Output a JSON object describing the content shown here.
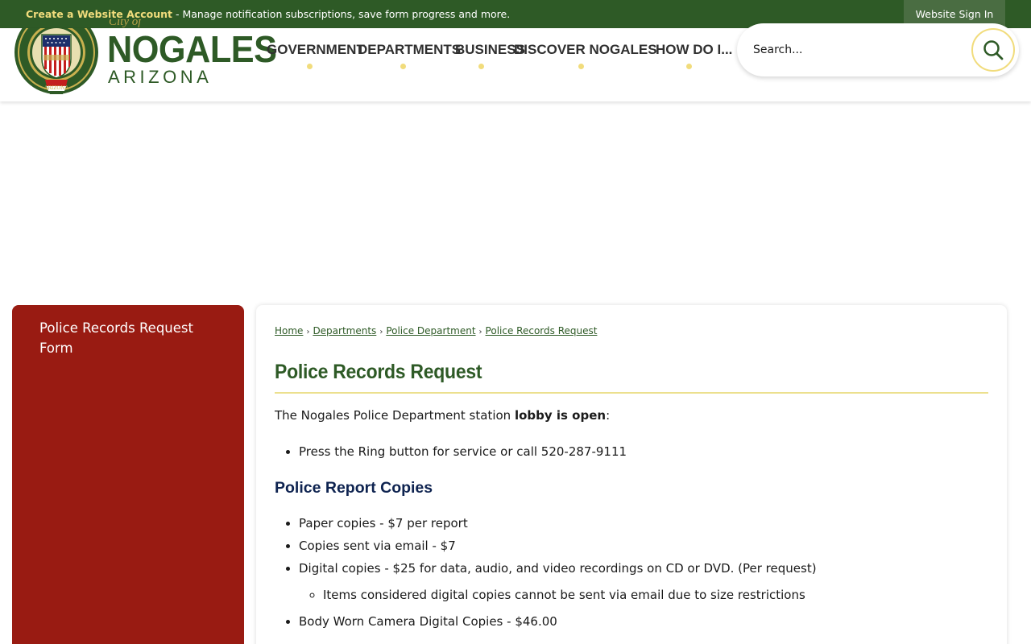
{
  "topbar": {
    "create_account": "Create a Website Account",
    "message": " - Manage notification subscriptions, save form progress and more.",
    "sign_in": "Website Sign In"
  },
  "logo": {
    "small": "City of",
    "name": "NOGALES",
    "state": "ARIZONA",
    "seal_icon": "city-seal"
  },
  "nav": [
    {
      "label": "GOVERNMENT"
    },
    {
      "label": "DEPARTMENTS"
    },
    {
      "label": "BUSINESS"
    },
    {
      "label": "DISCOVER NOGALES"
    },
    {
      "label": "HOW DO I..."
    }
  ],
  "search": {
    "placeholder": "Search...",
    "icon": "search-icon"
  },
  "sidebar": {
    "link": "Police Records Request Form"
  },
  "breadcrumb": [
    "Home",
    "Departments",
    "Police Department",
    "Police Records Request"
  ],
  "content": {
    "title": "Police Records Request",
    "intro_prefix": "The Nogales Police Department station ",
    "intro_bold": "lobby is open",
    "intro_suffix": ":",
    "intro_bullet": "Press the Ring button for service or call 520-287-9111",
    "copies_heading": "Police Report Copies",
    "copies": [
      "Paper copies - $7 per report",
      "Copies sent via email - $7",
      "Digital copies - $25 for data, audio, and video recordings on CD or DVD. (Per request)"
    ],
    "copies_sub": "Items considered digital copies cannot be sent via email due to size restrictions",
    "copies_last": "Body Worn Camera Digital Copies - $46.00"
  },
  "colors": {
    "brand_green": "#2e5a26",
    "accent_gold": "#f1dc7c",
    "sidebar_red": "#991b12",
    "heading_navy": "#0e2350"
  }
}
